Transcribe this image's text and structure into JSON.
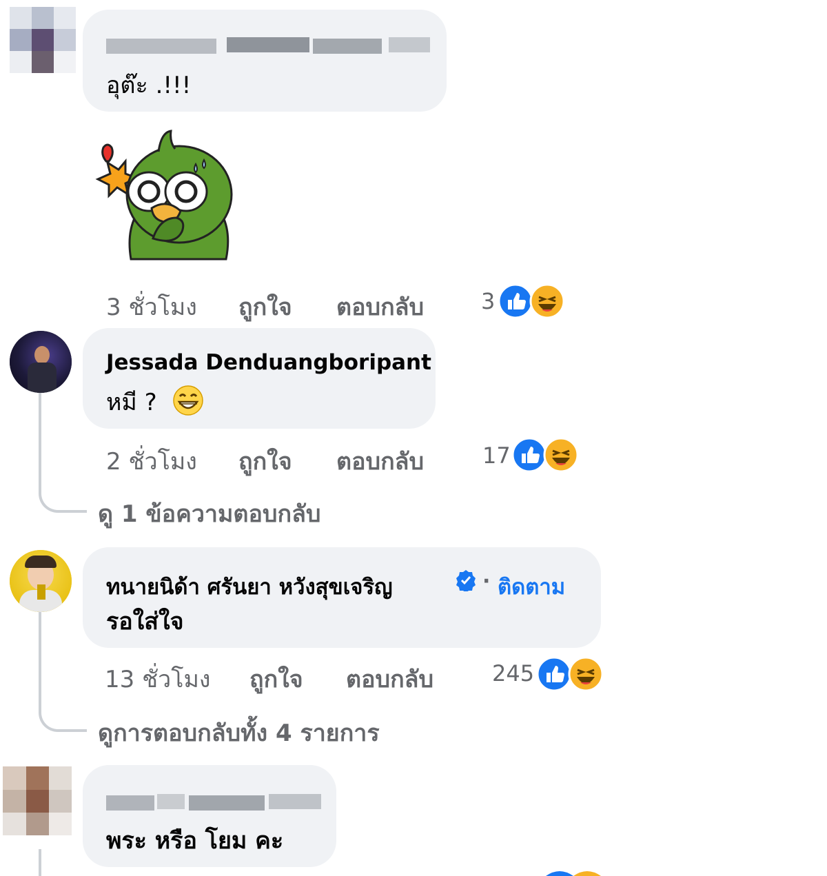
{
  "comments": [
    {
      "author": "",
      "text": "อุต๊ะ .!!!",
      "time": "3 ชั่วโมง",
      "like_label": "ถูกใจ",
      "reply_label": "ตอบกลับ",
      "reaction_count": "3",
      "sticker": "parrot-sticker"
    },
    {
      "author": "Jessada Denduangboripant",
      "text": "หมี ?",
      "time": "2 ชั่วโมง",
      "like_label": "ถูกใจ",
      "reply_label": "ตอบกลับ",
      "reaction_count": "17",
      "view_replies": "ดู 1 ข้อความตอบกลับ"
    },
    {
      "author": "ทนายนิด้า ศรันยา หวังสุขเจริญ",
      "dot": "·",
      "follow": "ติดตาม",
      "text": "รอใส่ใจ",
      "time": "13 ชั่วโมง",
      "like_label": "ถูกใจ",
      "reply_label": "ตอบกลับ",
      "reaction_count": "245",
      "view_replies": "ดูการตอบกลับทั้ง 4 รายการ"
    },
    {
      "author": "",
      "text": "พระ หรือ โยม คะ"
    }
  ],
  "colors": {
    "bubble": "#f0f2f5",
    "meta_text": "#65676b",
    "like_blue": "#1877f2",
    "haha_yellow": "#f7b125",
    "verified_blue": "#1877f2"
  }
}
